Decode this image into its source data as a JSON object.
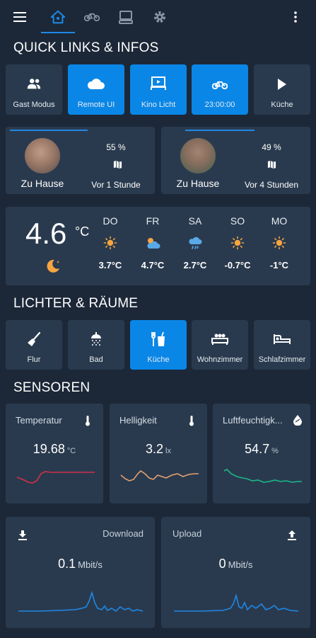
{
  "quick_links": {
    "title": "QUICK LINKS & INFOS",
    "items": [
      {
        "label": "Gast Modus",
        "icon": "people-icon",
        "active": false
      },
      {
        "label": "Remote UI",
        "icon": "cloud-icon",
        "active": true
      },
      {
        "label": "Kino Licht",
        "icon": "projector-screen-icon",
        "active": true
      },
      {
        "label": "23:00:00",
        "icon": "bike-icon",
        "active": true
      },
      {
        "label": "Küche",
        "icon": "play-icon",
        "active": false
      }
    ]
  },
  "persons": [
    {
      "status": "Zu Hause",
      "battery": "55 %",
      "last_seen": "Vor 1 Stunde"
    },
    {
      "status": "Zu Hause",
      "battery": "49 %",
      "last_seen": "Vor 4 Stunden"
    }
  ],
  "weather": {
    "temp": "4.6",
    "unit": "°C",
    "forecast": [
      {
        "day": "DO",
        "icon": "sun-icon",
        "temp": "3.7°C"
      },
      {
        "day": "FR",
        "icon": "partly-cloudy-icon",
        "temp": "4.7°C"
      },
      {
        "day": "SA",
        "icon": "rain-icon",
        "temp": "2.7°C"
      },
      {
        "day": "SO",
        "icon": "sun-icon",
        "temp": "-0.7°C"
      },
      {
        "day": "MO",
        "icon": "sun-icon",
        "temp": "-1°C"
      }
    ]
  },
  "rooms": {
    "title": "LICHTER & RÄUME",
    "items": [
      {
        "label": "Flur",
        "icon": "broom-icon",
        "active": false
      },
      {
        "label": "Bad",
        "icon": "shower-icon",
        "active": false
      },
      {
        "label": "Küche",
        "icon": "cutlery-icon",
        "active": true
      },
      {
        "label": "Wohnzimmer",
        "icon": "sofa-icon",
        "active": false
      },
      {
        "label": "Schlafzimmer",
        "icon": "bed-icon",
        "active": false
      }
    ]
  },
  "sensors": {
    "title": "SENSOREN",
    "items": [
      {
        "name": "Temperatur",
        "value": "19.68",
        "unit": "°C",
        "icon": "thermometer-icon",
        "color": "#d0304a"
      },
      {
        "name": "Helligkeit",
        "value": "3.2",
        "unit": "lx",
        "icon": "thermometer-icon",
        "color": "#e0a070"
      },
      {
        "name": "Luftfeuchtigk...",
        "value": "54.7",
        "unit": "%",
        "icon": "water-drop-icon",
        "color": "#1ab88a"
      }
    ]
  },
  "network": {
    "download": {
      "name": "Download",
      "value": "0.1",
      "unit": "Mbit/s"
    },
    "upload": {
      "name": "Upload",
      "value": "0",
      "unit": "Mbit/s"
    },
    "color": "#1e88e5"
  },
  "colors": {
    "background": "#1c2838",
    "card": "#2a3a4e",
    "accent": "#0a86e6"
  }
}
